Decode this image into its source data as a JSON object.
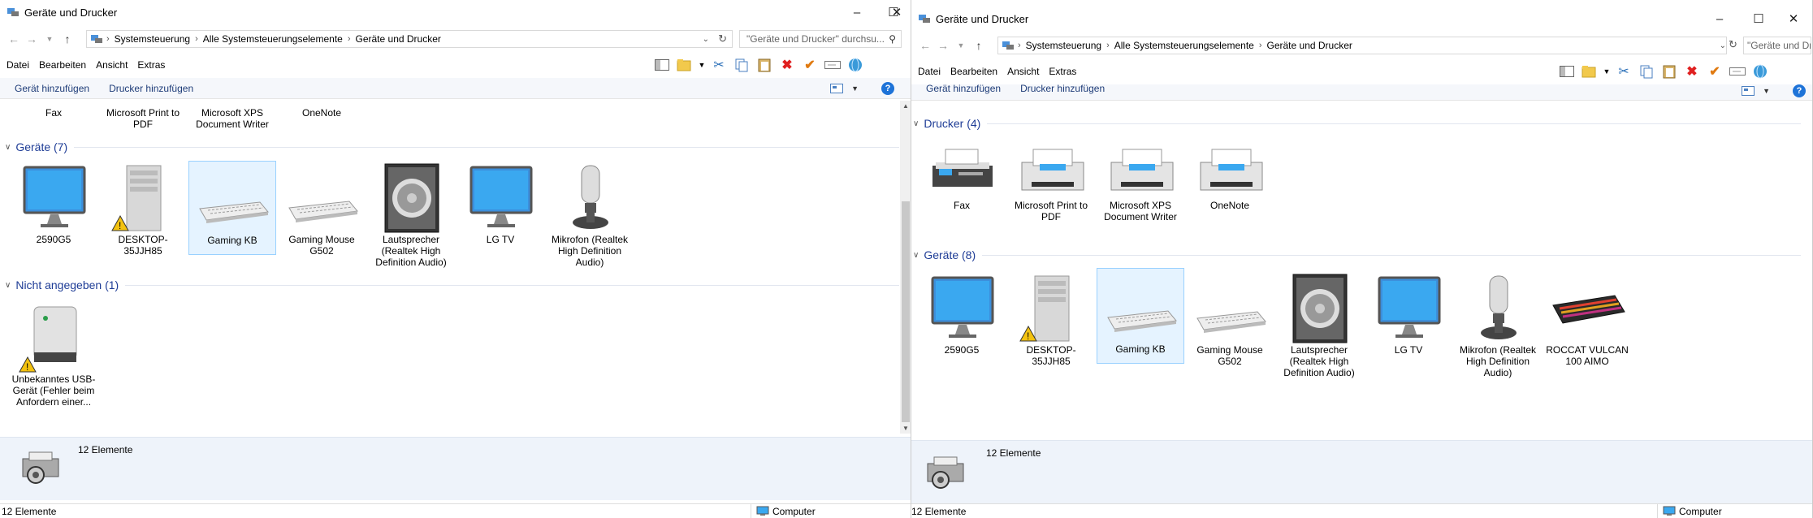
{
  "left": {
    "title": "Geräte und Drucker",
    "breadcrumb": [
      "Systemsteuerung",
      "Alle Systemsteuerungselemente",
      "Geräte und Drucker"
    ],
    "search_placeholder": "\"Geräte und Drucker\" durchsu...",
    "menu": [
      "Datei",
      "Bearbeiten",
      "Ansicht",
      "Extras"
    ],
    "commands": [
      "Gerät hinzufügen",
      "Drucker hinzufügen"
    ],
    "printers_partial": [
      {
        "label": "Fax"
      },
      {
        "label": "Microsoft Print to PDF"
      },
      {
        "label": "Microsoft XPS Document Writer"
      },
      {
        "label": "OneNote"
      }
    ],
    "devices_header": "Geräte (7)",
    "devices": [
      {
        "label": "2590G5",
        "icon": "monitor-icon"
      },
      {
        "label": "DESKTOP-35JJH85",
        "icon": "computer-tower-icon",
        "warning": true
      },
      {
        "label": "Gaming KB",
        "icon": "keyboard-icon",
        "selected": true
      },
      {
        "label": "Gaming Mouse G502",
        "icon": "keyboard-icon"
      },
      {
        "label": "Lautsprecher (Realtek High Definition Audio)",
        "icon": "speaker-icon"
      },
      {
        "label": "LG TV",
        "icon": "monitor-icon"
      },
      {
        "label": "Mikrofon (Realtek High Definition Audio)",
        "icon": "microphone-icon"
      }
    ],
    "unspecified_header": "Nicht angegeben (1)",
    "unspecified": [
      {
        "label": "Unbekanntes USB-Gerät (Fehler beim Anfordern einer...",
        "icon": "usb-device-icon",
        "warning": true
      }
    ],
    "details_count": "12 Elemente",
    "status_count": "12 Elemente",
    "status_location": "Computer"
  },
  "right": {
    "title": "Geräte und Drucker",
    "breadcrumb": [
      "Systemsteuerung",
      "Alle Systemsteuerungselemente",
      "Geräte und Drucker"
    ],
    "search_placeholder": "\"Geräte und Drucker\" durchsu...",
    "menu": [
      "Datei",
      "Bearbeiten",
      "Ansicht",
      "Extras"
    ],
    "commands": [
      "Gerät hinzufügen",
      "Drucker hinzufügen"
    ],
    "printers_header": "Drucker (4)",
    "printers": [
      {
        "label": "Fax",
        "icon": "fax-icon"
      },
      {
        "label": "Microsoft Print to PDF",
        "icon": "printer-icon"
      },
      {
        "label": "Microsoft XPS Document Writer",
        "icon": "printer-icon"
      },
      {
        "label": "OneNote",
        "icon": "printer-icon"
      }
    ],
    "devices_header": "Geräte (8)",
    "devices": [
      {
        "label": "2590G5",
        "icon": "monitor-icon"
      },
      {
        "label": "DESKTOP-35JJH85",
        "icon": "computer-tower-icon",
        "warning": true
      },
      {
        "label": "Gaming KB",
        "icon": "keyboard-icon",
        "selected": true
      },
      {
        "label": "Gaming Mouse G502",
        "icon": "keyboard-icon"
      },
      {
        "label": "Lautsprecher (Realtek High Definition Audio)",
        "icon": "speaker-icon"
      },
      {
        "label": "LG TV",
        "icon": "monitor-icon"
      },
      {
        "label": "Mikrofon (Realtek High Definition Audio)",
        "icon": "microphone-icon"
      },
      {
        "label": "ROCCAT VULCAN 100 AIMO",
        "icon": "rgb-keyboard-icon"
      }
    ],
    "details_count": "12 Elemente",
    "status_count": "12 Elemente",
    "status_location": "Computer"
  },
  "colors": {
    "link": "#1e3c78",
    "group_header": "#1e3c96",
    "selection": "#e5f3ff",
    "details_bg": "#eef3fa",
    "delete": "#e02020",
    "check": "#e07a10"
  }
}
